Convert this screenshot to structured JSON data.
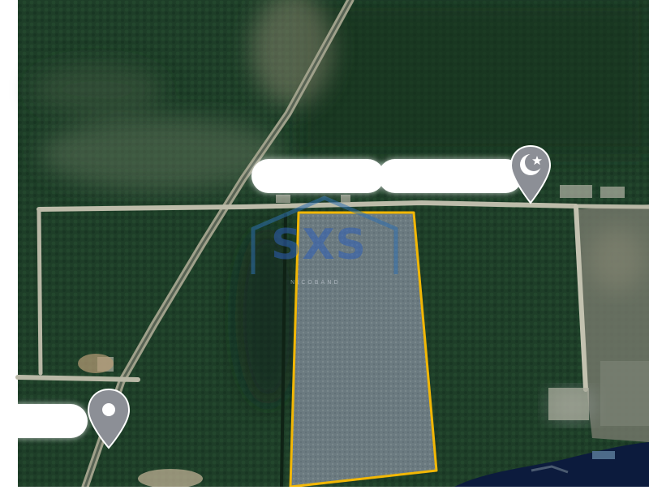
{
  "map": {
    "view": "satellite",
    "colors": {
      "forest_dark": "#1c3a26",
      "forest_mid": "#2a4f33",
      "clearing": "#6d7a6a",
      "dirt_road": "#b9b8a6",
      "water": "#0a1a3a",
      "parcel_fill": "#6e7d82",
      "parcel_outline": "#f2b705",
      "brand_blue": "#2f5fb8"
    }
  },
  "labels": {
    "top_left": "",
    "top_right": "",
    "bottom": ""
  },
  "markers": {
    "top": {
      "icon": "crescent-star-icon"
    },
    "bottom": {
      "icon": "map-pin-icon"
    }
  },
  "watermark": {
    "brand": "SXS",
    "tagline": "NICOBAND"
  }
}
